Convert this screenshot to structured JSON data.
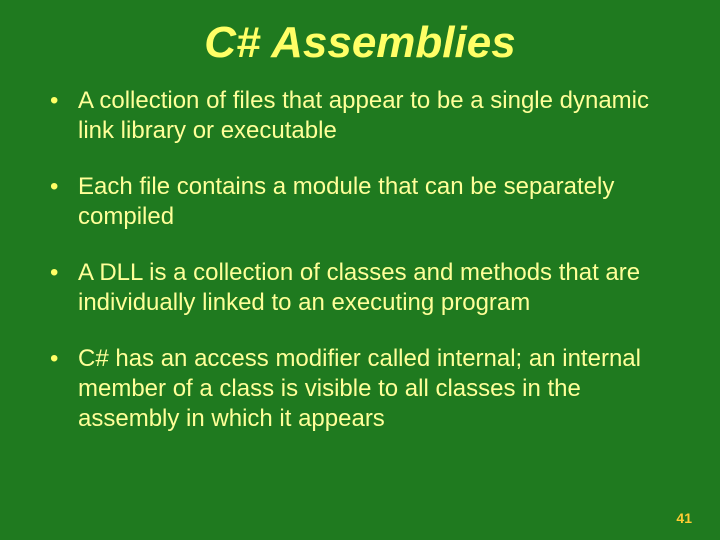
{
  "title": "C# Assemblies",
  "bullets": [
    "A collection of files that appear to be a single dynamic link library or executable",
    "Each file contains a module that can be separately compiled",
    "A DLL is a collection of classes and methods that are individually linked to an executing program",
    "C# has an access modifier called internal; an internal member of a class is visible to all classes in the assembly in which it appears"
  ],
  "page_number": "41"
}
